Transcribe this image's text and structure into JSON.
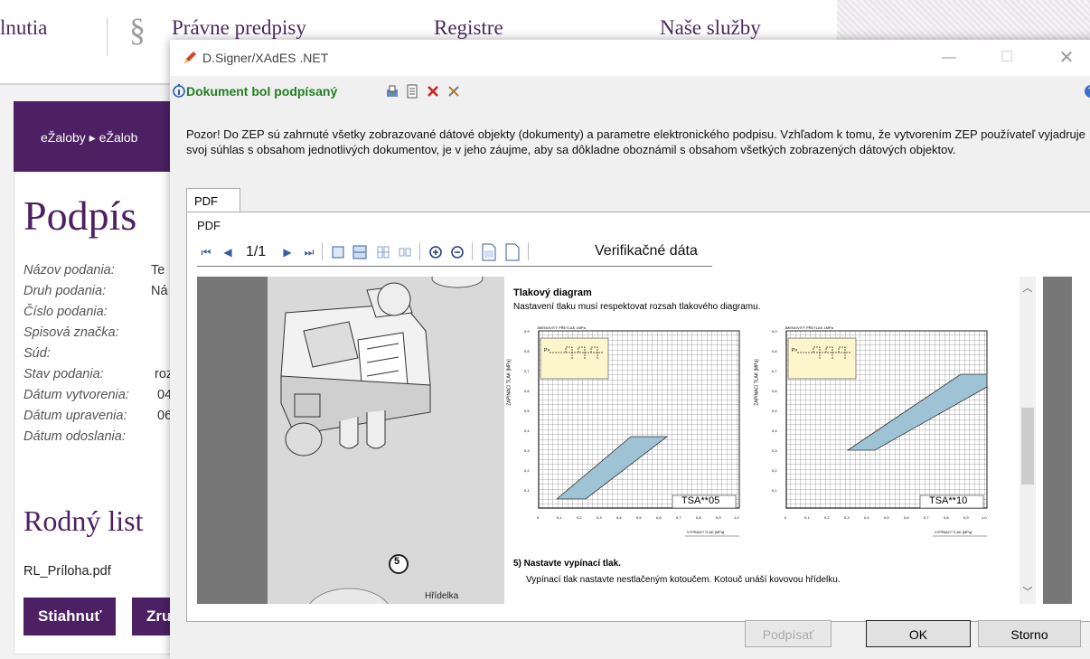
{
  "background": {
    "nav": {
      "item1": "lnutia",
      "item2": "Právne predpisy",
      "item3": "Registre",
      "item4": "Naše služby",
      "paragraph_symbol": "§"
    },
    "breadcrumb": {
      "item1": "eŽaloby",
      "item2": "eŽalob"
    },
    "title": "Podpís",
    "meta": [
      {
        "label": "Názov podania:",
        "value": "Te"
      },
      {
        "label": "Druh podania:",
        "value": "Ná"
      },
      {
        "label": "Číslo podania:",
        "value": ""
      },
      {
        "label": "Spisová značka:",
        "value": ""
      },
      {
        "label": "Súd:",
        "value": ""
      },
      {
        "label": "Stav podania:",
        "value": "roz"
      },
      {
        "label": "Dátum vytvorenia:",
        "value": "04"
      },
      {
        "label": "Dátum upravenia:",
        "value": "06"
      },
      {
        "label": "Dátum odoslania:",
        "value": ""
      }
    ],
    "section_title": "Rodný list",
    "file_name": "RL_Príloha.pdf",
    "download_label": "Stiahnuť",
    "cancel_label": "Zru"
  },
  "dialog": {
    "title": "D.Signer/XAdES .NET",
    "status": "Dokument bol podpísaný",
    "notice": "Pozor! Do ZEP sú zahrnuté všetky zobrazované dátové objekty (dokumenty) a parametre elektronického podpisu. Vzhľadom k tomu, že vytvorením ZEP používateľ vyjadruje svoj súhlas s obsahom jednotlivých dokumentov, je v jeho záujme, aby sa dôkladne oboznámil s obsahom všetkých zobrazených dátových objektov.",
    "tab_label": "PDF",
    "viewer_label": "PDF",
    "page_indicator": "1/1",
    "verification_label": "Verifikačné dáta",
    "buttons": {
      "sign": "Podpísať",
      "ok": "OK",
      "cancel": "Storno"
    }
  },
  "pdf": {
    "heading": "Tlakový diagram",
    "subheading": "Nastavení tlaku musí respektovat rozsah tlakového diagramu.",
    "chart_y_title": "ZAPÍNACÍ TLAK [MPa]",
    "chart_top_label": "JMENOVITÝ PŘETLAK 1MPa",
    "chart_x_title": "VYPÍNACÍ TLAK [MPa]",
    "legend_p": "P>",
    "y_ticks": [
      "0,9",
      "0,8",
      "0,7",
      "0,6",
      "0,5",
      "0,4",
      "0,3",
      "0,2",
      "0,1"
    ],
    "x_ticks": [
      "0",
      "0,1",
      "0,2",
      "0,3",
      "0,4",
      "0,5",
      "0,6",
      "0,7",
      "0,8",
      "0,9",
      "1,0"
    ],
    "chart1_model": "TSA**05",
    "chart2_model": "TSA**10",
    "step_number": "5",
    "step_title": "5)  Nastavte vypínací tlak.",
    "step_text": "Vypínací tlak nastavte nestlačeným kotoučem. Kotouč unáší kovovou hřídelku.",
    "shaft_label": "Hřídelka"
  },
  "colors": {
    "brand": "#4c2063",
    "status_ok": "#208020",
    "band": "#9ec3d4",
    "diagram_box": "#fdf5cc"
  }
}
